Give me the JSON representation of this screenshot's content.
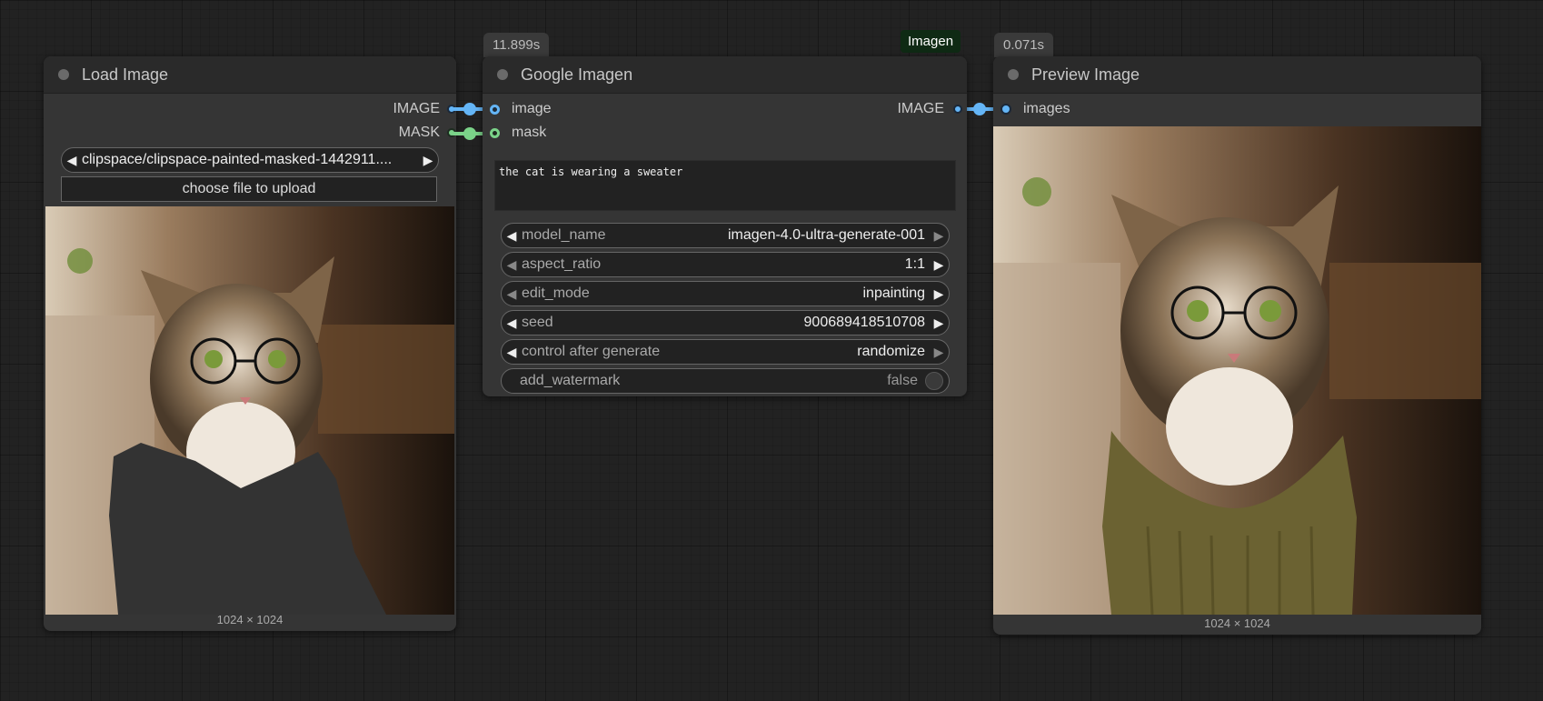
{
  "nodes": {
    "load_image": {
      "title": "Load Image",
      "outputs": [
        "IMAGE",
        "MASK"
      ],
      "file_value": "clipspace/clipspace-painted-masked-1442911....",
      "upload_label": "choose file to upload",
      "image_size": "1024 × 1024"
    },
    "google_imagen": {
      "title": "Google Imagen",
      "time_badge": "11.899s",
      "exec_badge": "Imagen",
      "inputs": [
        "image",
        "mask"
      ],
      "output": "IMAGE",
      "prompt": "the cat is wearing a sweater",
      "widgets": [
        {
          "label": "model_name",
          "value": "imagen-4.0-ultra-generate-001"
        },
        {
          "label": "aspect_ratio",
          "value": "1:1"
        },
        {
          "label": "edit_mode",
          "value": "inpainting"
        },
        {
          "label": "seed",
          "value": "900689418510708"
        },
        {
          "label": "control after generate",
          "value": "randomize"
        },
        {
          "label": "add_watermark",
          "value": "false"
        }
      ]
    },
    "preview_image": {
      "title": "Preview Image",
      "time_badge": "0.071s",
      "input": "images",
      "image_size": "1024 × 1024"
    }
  },
  "colors": {
    "image_link": "#64b5f6",
    "mask_link": "#7bd389",
    "canvas": "#222222",
    "node_body": "#353535"
  },
  "icons": [
    "arrow-left-icon",
    "arrow-right-icon",
    "status-dot-icon",
    "toggle-icon"
  ]
}
